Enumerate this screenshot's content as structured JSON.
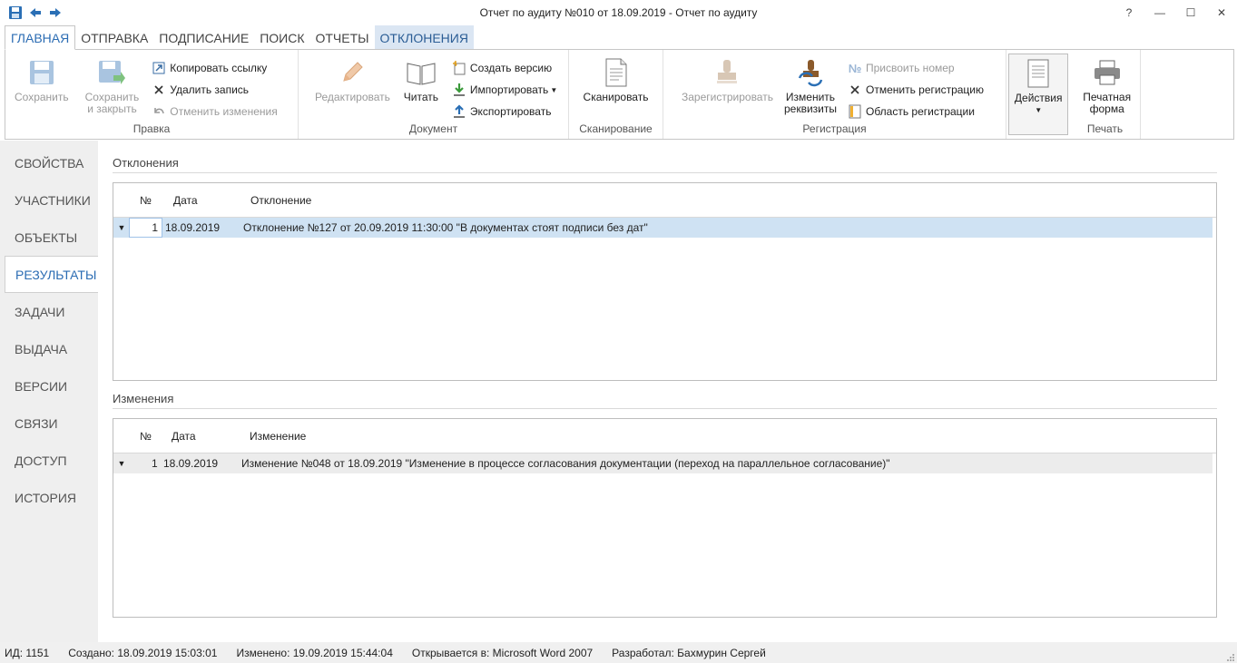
{
  "window": {
    "title": "Отчет по аудиту №010 от 18.09.2019 - Отчет по аудиту",
    "help": "?",
    "minimize": "—",
    "maximize": "☐",
    "close": "✕"
  },
  "tabs": [
    {
      "label": "ГЛАВНАЯ"
    },
    {
      "label": "ОТПРАВКА"
    },
    {
      "label": "ПОДПИСАНИЕ"
    },
    {
      "label": "ПОИСК"
    },
    {
      "label": "ОТЧЕТЫ"
    },
    {
      "label": "ОТКЛОНЕНИЯ"
    }
  ],
  "ribbon": {
    "edit_group": {
      "label": "Правка",
      "save": "Сохранить",
      "save_close_line1": "Сохранить",
      "save_close_line2": "и закрыть",
      "copy_link": "Копировать ссылку",
      "delete_record": "Удалить запись",
      "undo_changes": "Отменить изменения"
    },
    "document_group": {
      "label": "Документ",
      "edit": "Редактировать",
      "read": "Читать",
      "create_version": "Создать версию",
      "import": "Импортировать",
      "export": "Экспортировать"
    },
    "scan_group": {
      "label": "Сканирование",
      "scan": "Сканировать"
    },
    "registration_group": {
      "label": "Регистрация",
      "register": "Зарегистрировать",
      "change_line1": "Изменить",
      "change_line2": "реквизиты",
      "assign_number": "Присвоить номер",
      "cancel_registration": "Отменить регистрацию",
      "registration_area": "Область регистрации"
    },
    "print_group": {
      "label": "Печать",
      "actions": "Действия",
      "print_line1": "Печатная",
      "print_line2": "форма"
    }
  },
  "leftnav": [
    {
      "label": "СВОЙСТВА"
    },
    {
      "label": "УЧАСТНИКИ"
    },
    {
      "label": "ОБЪЕКТЫ"
    },
    {
      "label": "РЕЗУЛЬТАТЫ"
    },
    {
      "label": "ЗАДАЧИ"
    },
    {
      "label": "ВЫДАЧА"
    },
    {
      "label": "ВЕРСИИ"
    },
    {
      "label": "СВЯЗИ"
    },
    {
      "label": "ДОСТУП"
    },
    {
      "label": "ИСТОРИЯ"
    }
  ],
  "deviations": {
    "title": "Отклонения",
    "columns": {
      "num": "№",
      "date": "Дата",
      "desc": "Отклонение"
    },
    "rows": [
      {
        "num": "1",
        "date": "18.09.2019",
        "desc": "Отклонение №127 от 20.09.2019 11:30:00 \"В документах стоят подписи без дат\""
      }
    ]
  },
  "changes": {
    "title": "Изменения",
    "columns": {
      "num": "№",
      "date": "Дата",
      "desc": "Изменение"
    },
    "rows": [
      {
        "num": "1",
        "date": "18.09.2019",
        "desc": "Изменение №048 от 18.09.2019 \"Изменение в процессе согласования документации (переход на параллельное согласование)\""
      }
    ]
  },
  "statusbar": {
    "id": "ИД: 1151",
    "created": "Создано: 18.09.2019 15:03:01",
    "modified": "Изменено: 19.09.2019 15:44:04",
    "opens_in": "Открывается в: Microsoft Word 2007",
    "developer": "Разработал: Бахмурин Сергей"
  },
  "colors": {
    "accent": "#2b6cb3",
    "selected_row": "#cfe2f3",
    "context_tab": "#dbe6f3"
  }
}
